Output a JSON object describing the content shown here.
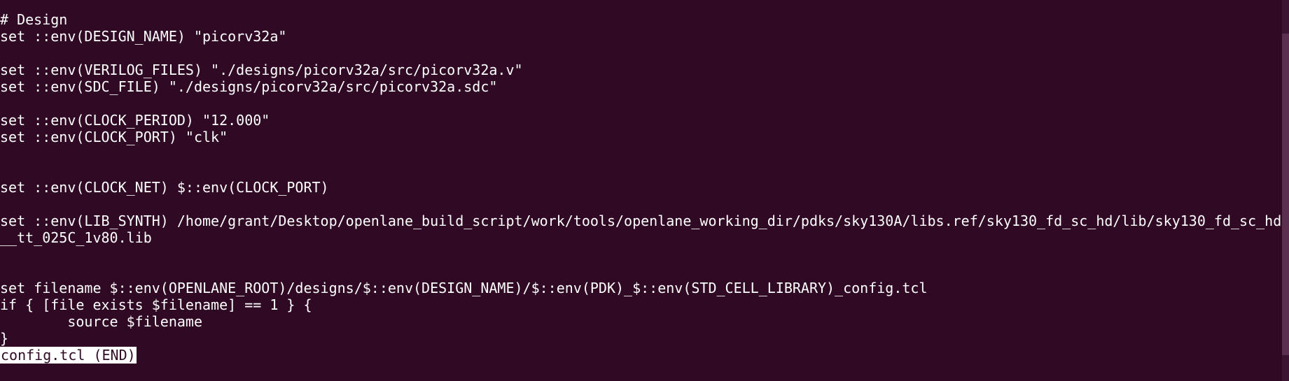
{
  "terminal": {
    "lines": [
      "# Design",
      "set ::env(DESIGN_NAME) \"picorv32a\"",
      "",
      "set ::env(VERILOG_FILES) \"./designs/picorv32a/src/picorv32a.v\"",
      "set ::env(SDC_FILE) \"./designs/picorv32a/src/picorv32a.sdc\"",
      "",
      "set ::env(CLOCK_PERIOD) \"12.000\"",
      "set ::env(CLOCK_PORT) \"clk\"",
      "",
      "",
      "set ::env(CLOCK_NET) $::env(CLOCK_PORT)",
      "",
      "set ::env(LIB_SYNTH) /home/grant/Desktop/openlane_build_script/work/tools/openlane_working_dir/pdks/sky130A/libs.ref/sky130_fd_sc_hd/lib/sky130_fd_sc_hd",
      "__tt_025C_1v80.lib",
      "",
      "",
      "set filename $::env(OPENLANE_ROOT)/designs/$::env(DESIGN_NAME)/$::env(PDK)_$::env(STD_CELL_LIBRARY)_config.tcl",
      "if { [file exists $filename] == 1 } {",
      "        source $filename",
      "}"
    ],
    "status_line": "config.tcl (END)"
  },
  "colors": {
    "background": "#300a24",
    "foreground": "#ffffff"
  }
}
